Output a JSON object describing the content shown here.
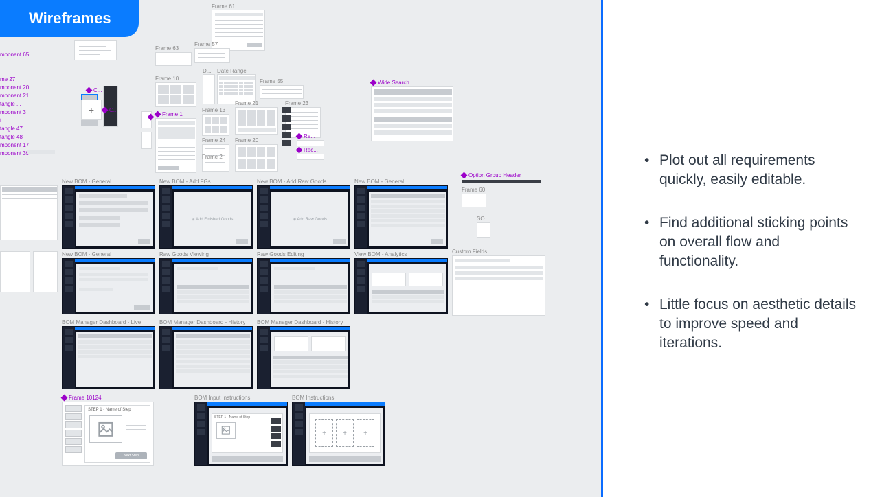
{
  "title_tab": "Wireframes",
  "bullets": [
    "Plot out all requirements quickly, easily editable.",
    "Find additional sticking points on overall flow and functionality.",
    "Little focus on aesthetic details to improve speed and iterations."
  ],
  "edge_labels_1": [
    "mponent 65"
  ],
  "edge_labels_2": [
    "me 27",
    "mponent 20",
    "mponent 21",
    "tangle ...",
    "mponent 3",
    "t...",
    "tangle 47",
    "tangle 48",
    "mponent 17",
    "mponent 39",
    "..."
  ],
  "top_frame_labels": {
    "f61": "Frame 61",
    "f57": "Frame 57",
    "f63": "Frame 63",
    "f10": "Frame 10",
    "d": "D...",
    "date_range": "Date Range",
    "f55": "Frame 55",
    "f13": "Frame 13",
    "f21": "Frame 21",
    "f23": "Frame 23",
    "f20": "Frame 20",
    "f24": "Frame 24",
    "f2": "Frame 2",
    "wide_search": "Wide Search",
    "option_group": "Option Group Header",
    "frame1": "Frame 1",
    "c": "C...",
    "cc": "C...",
    "re": "Re...",
    "rec": "Rec...",
    "f60": "Frame 60",
    "so": "SO...",
    "custom_fields": "Custom Fields"
  },
  "row1_labels": [
    "New BOM - General",
    "New BOM - Add FGs",
    "New BOM - Add Raw Goods",
    "New BOM - General"
  ],
  "row2_labels": [
    "New BOM - General",
    "Raw Goods Viewing",
    "Raw Goods Editing",
    "View BOM - Analytics"
  ],
  "row3_labels": [
    "BOM Manager Dashboard - Live",
    "BOM Manager Dashboard - History",
    "BOM Manager Dashboard - History"
  ],
  "row4": {
    "f10124": "Frame 10124",
    "bom_input": "BOM Input Instructions",
    "bom_instr": "BOM Instructions",
    "step_card": "STEP 1 - Name of Step",
    "next": "Next Step"
  }
}
